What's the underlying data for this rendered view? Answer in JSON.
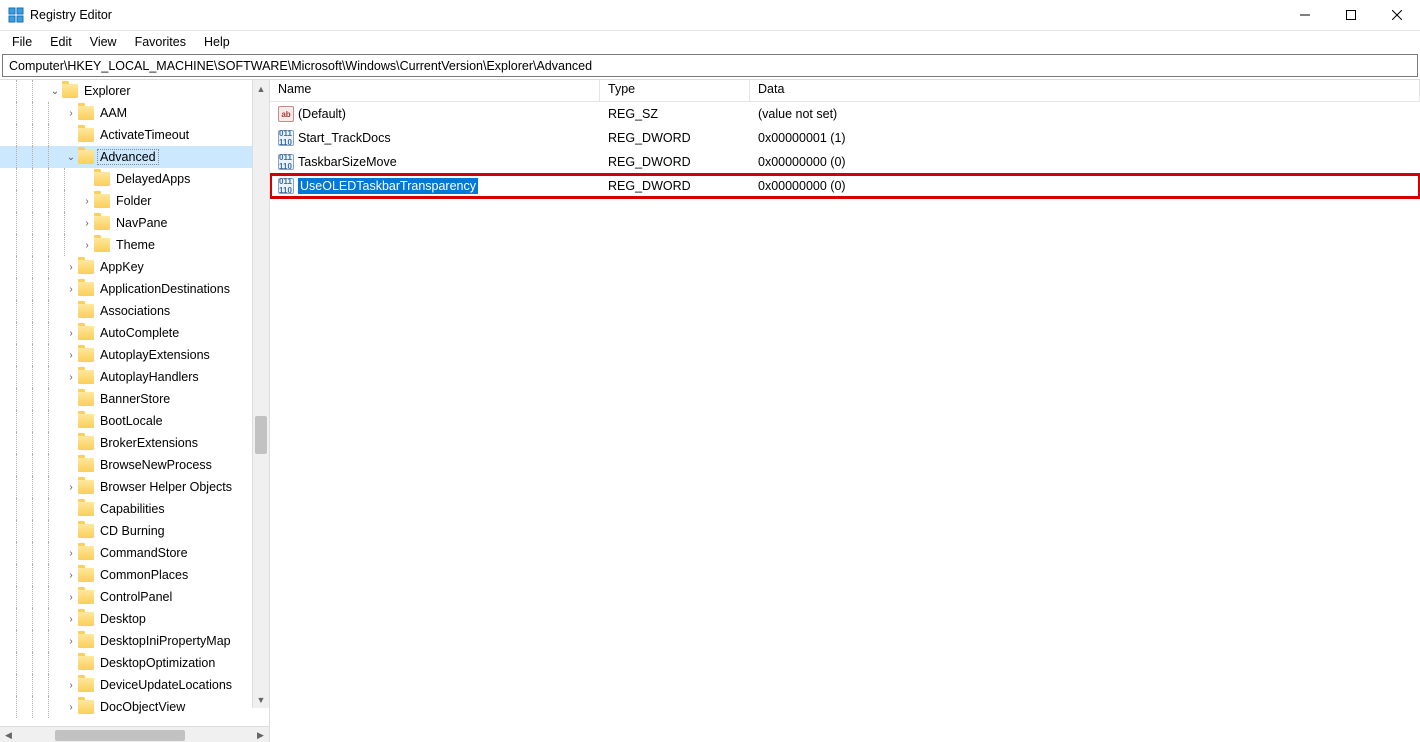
{
  "window": {
    "title": "Registry Editor"
  },
  "menu": {
    "file": "File",
    "edit": "Edit",
    "view": "View",
    "favorites": "Favorites",
    "help": "Help"
  },
  "address": "Computer\\HKEY_LOCAL_MACHINE\\SOFTWARE\\Microsoft\\Windows\\CurrentVersion\\Explorer\\Advanced",
  "tree": [
    {
      "indent": 3,
      "twisty": "v",
      "label": "Explorer",
      "selected": false
    },
    {
      "indent": 4,
      "twisty": ">",
      "label": "AAM"
    },
    {
      "indent": 4,
      "twisty": "",
      "label": "ActivateTimeout"
    },
    {
      "indent": 4,
      "twisty": "v",
      "label": "Advanced",
      "selected": true
    },
    {
      "indent": 5,
      "twisty": "",
      "label": "DelayedApps"
    },
    {
      "indent": 5,
      "twisty": ">",
      "label": "Folder"
    },
    {
      "indent": 5,
      "twisty": ">",
      "label": "NavPane"
    },
    {
      "indent": 5,
      "twisty": ">",
      "label": "Theme"
    },
    {
      "indent": 4,
      "twisty": ">",
      "label": "AppKey"
    },
    {
      "indent": 4,
      "twisty": ">",
      "label": "ApplicationDestinations"
    },
    {
      "indent": 4,
      "twisty": "",
      "label": "Associations"
    },
    {
      "indent": 4,
      "twisty": ">",
      "label": "AutoComplete"
    },
    {
      "indent": 4,
      "twisty": ">",
      "label": "AutoplayExtensions"
    },
    {
      "indent": 4,
      "twisty": ">",
      "label": "AutoplayHandlers"
    },
    {
      "indent": 4,
      "twisty": "",
      "label": "BannerStore"
    },
    {
      "indent": 4,
      "twisty": "",
      "label": "BootLocale"
    },
    {
      "indent": 4,
      "twisty": "",
      "label": "BrokerExtensions"
    },
    {
      "indent": 4,
      "twisty": "",
      "label": "BrowseNewProcess"
    },
    {
      "indent": 4,
      "twisty": ">",
      "label": "Browser Helper Objects"
    },
    {
      "indent": 4,
      "twisty": "",
      "label": "Capabilities"
    },
    {
      "indent": 4,
      "twisty": "",
      "label": "CD Burning"
    },
    {
      "indent": 4,
      "twisty": ">",
      "label": "CommandStore"
    },
    {
      "indent": 4,
      "twisty": ">",
      "label": "CommonPlaces"
    },
    {
      "indent": 4,
      "twisty": ">",
      "label": "ControlPanel"
    },
    {
      "indent": 4,
      "twisty": ">",
      "label": "Desktop"
    },
    {
      "indent": 4,
      "twisty": ">",
      "label": "DesktopIniPropertyMap"
    },
    {
      "indent": 4,
      "twisty": "",
      "label": "DesktopOptimization"
    },
    {
      "indent": 4,
      "twisty": ">",
      "label": "DeviceUpdateLocations"
    },
    {
      "indent": 4,
      "twisty": ">",
      "label": "DocObjectView"
    }
  ],
  "columns": {
    "name": "Name",
    "type": "Type",
    "data": "Data"
  },
  "values": [
    {
      "icon": "str",
      "name": "(Default)",
      "type": "REG_SZ",
      "data": "(value not set)",
      "selected": false,
      "highlight": false
    },
    {
      "icon": "bin",
      "name": "Start_TrackDocs",
      "type": "REG_DWORD",
      "data": "0x00000001 (1)",
      "selected": false,
      "highlight": false
    },
    {
      "icon": "bin",
      "name": "TaskbarSizeMove",
      "type": "REG_DWORD",
      "data": "0x00000000 (0)",
      "selected": false,
      "highlight": false
    },
    {
      "icon": "bin",
      "name": "UseOLEDTaskbarTransparency",
      "type": "REG_DWORD",
      "data": "0x00000000 (0)",
      "selected": true,
      "highlight": true
    }
  ]
}
